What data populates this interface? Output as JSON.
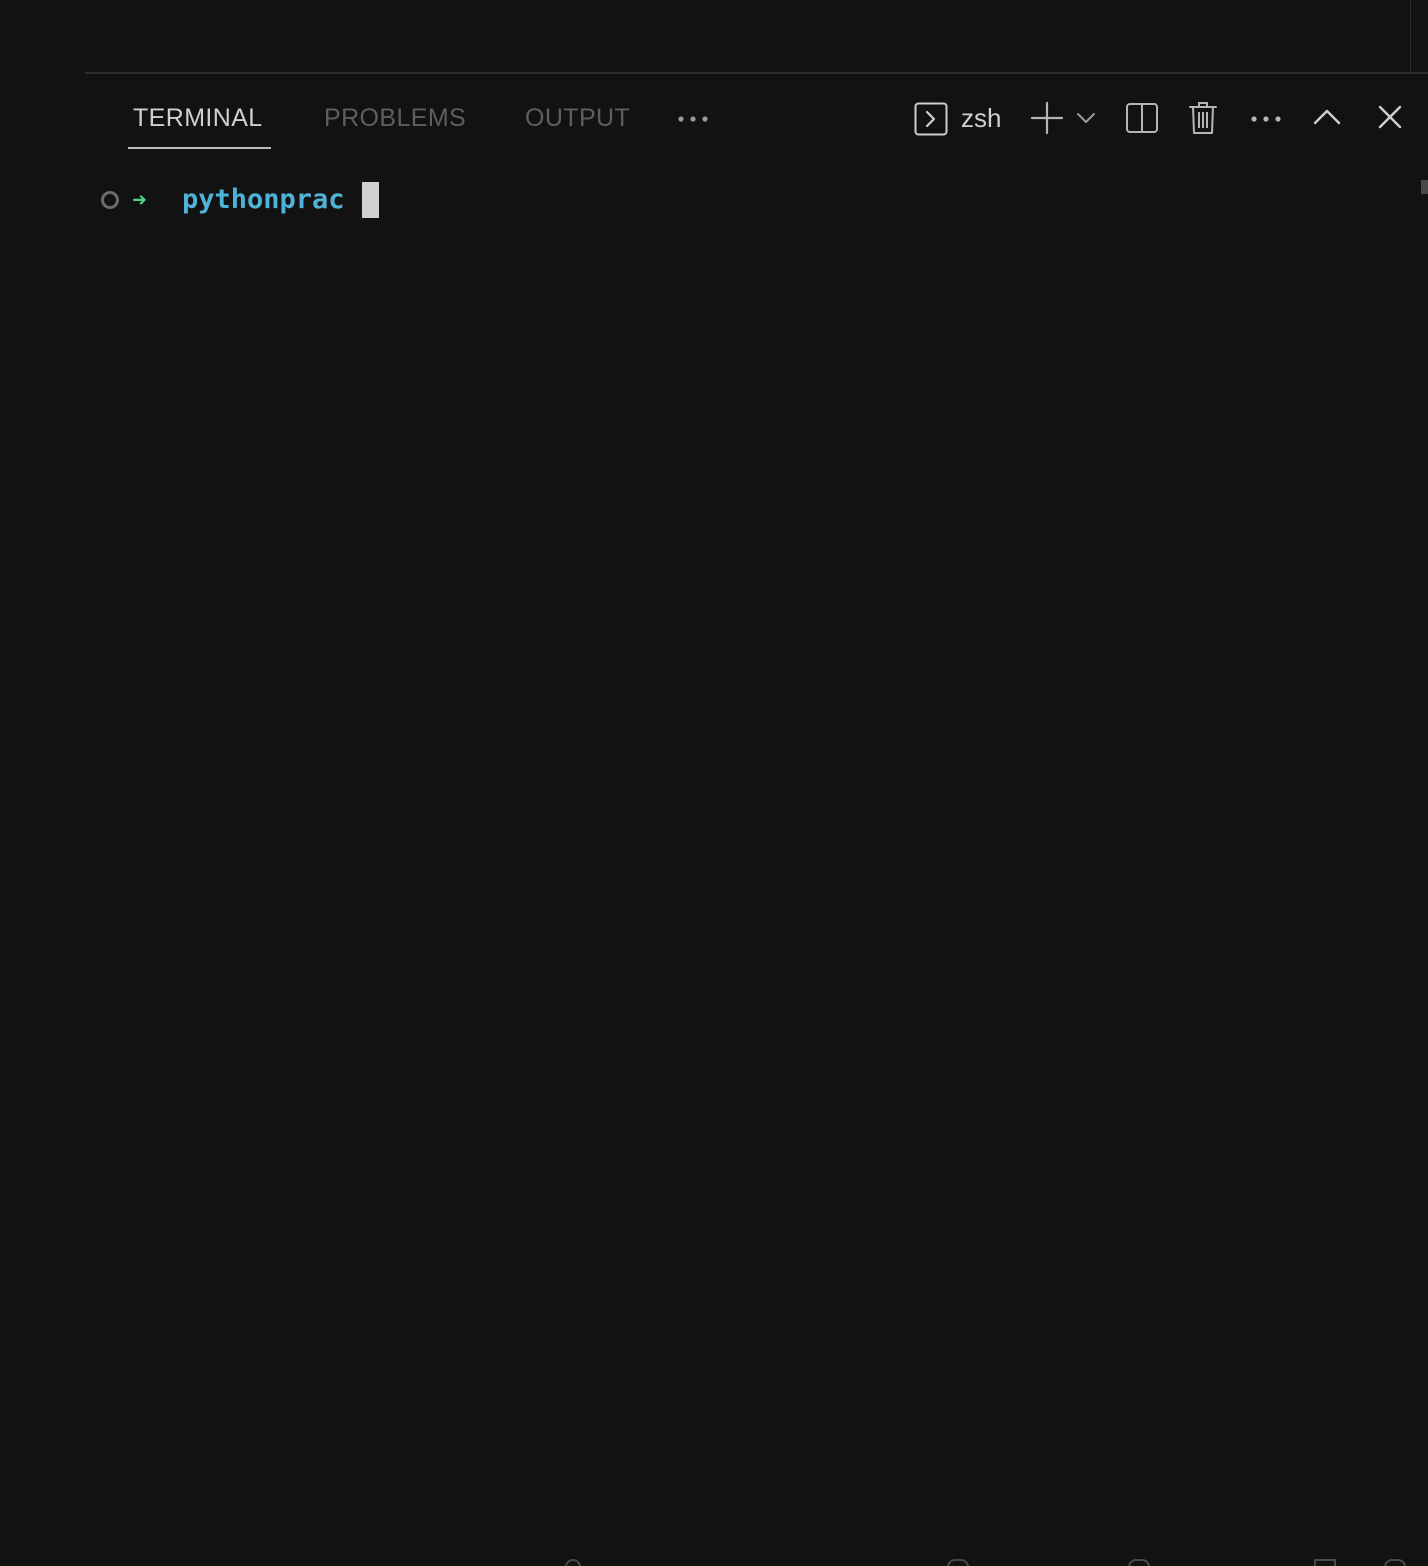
{
  "panel": {
    "tabs": [
      {
        "label": "TERMINAL",
        "active": true
      },
      {
        "label": "PROBLEMS",
        "active": false
      },
      {
        "label": "OUTPUT",
        "active": false
      }
    ],
    "more_tabs_icon": "ellipsis-icon",
    "toolbar": {
      "shell_icon": "terminal-icon",
      "shell_label": "zsh",
      "new_terminal_icon": "plus-icon",
      "launch_profile_icon": "chevron-down-icon",
      "split_icon": "split-terminal-icon",
      "kill_icon": "trash-icon",
      "more_actions_icon": "ellipsis-icon",
      "maximize_icon": "chevron-up-icon",
      "close_icon": "close-icon"
    }
  },
  "terminal": {
    "prompt_arrow": "➜",
    "directory": "pythonprac"
  },
  "colors": {
    "background": "#121212",
    "active_tab": "#cfcfcf",
    "inactive_tab": "#5e5e5e",
    "prompt_arrow": "#4fd18b",
    "directory": "#4fb3d9",
    "cursor": "#d0d0d0"
  }
}
